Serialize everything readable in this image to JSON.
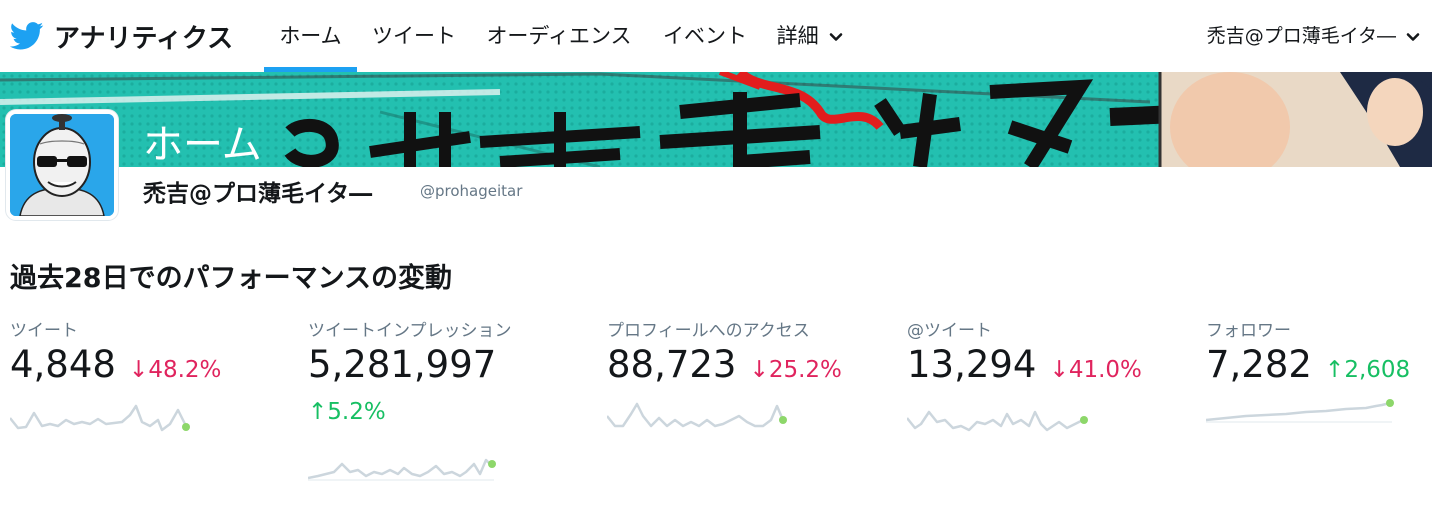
{
  "header": {
    "brand_title": "アナリティクス",
    "tabs": [
      {
        "label": "ホーム",
        "active": true
      },
      {
        "label": "ツイート"
      },
      {
        "label": "オーディエンス"
      },
      {
        "label": "イベント"
      },
      {
        "label": "詳細"
      }
    ],
    "account_name": "禿吉@プロ薄毛イタ―"
  },
  "banner": {
    "title": "ホーム"
  },
  "profile": {
    "name": "禿吉@プロ薄毛イタ―",
    "handle": "@prohageitar"
  },
  "section": {
    "title": "過去28日でのパフォーマンスの変動"
  },
  "metrics": [
    {
      "label": "ツイート",
      "value": "4,848",
      "delta": "48.2%",
      "direction": "down"
    },
    {
      "label": "ツイートインプレッション",
      "value": "5,281,997",
      "delta": "5.2%",
      "direction": "up"
    },
    {
      "label": "プロフィールへのアクセス",
      "value": "88,723",
      "delta": "25.2%",
      "direction": "down"
    },
    {
      "label": "@ツイート",
      "value": "13,294",
      "delta": "41.0%",
      "direction": "down"
    },
    {
      "label": "フォロワー",
      "value": "7,282",
      "delta": "2,608",
      "direction": "up"
    }
  ],
  "colors": {
    "accent": "#1da1f2",
    "down": "#e0245e",
    "up": "#17bf63",
    "sparkline": "#ccd6dd",
    "sparkline_end": "#8dd76a"
  }
}
